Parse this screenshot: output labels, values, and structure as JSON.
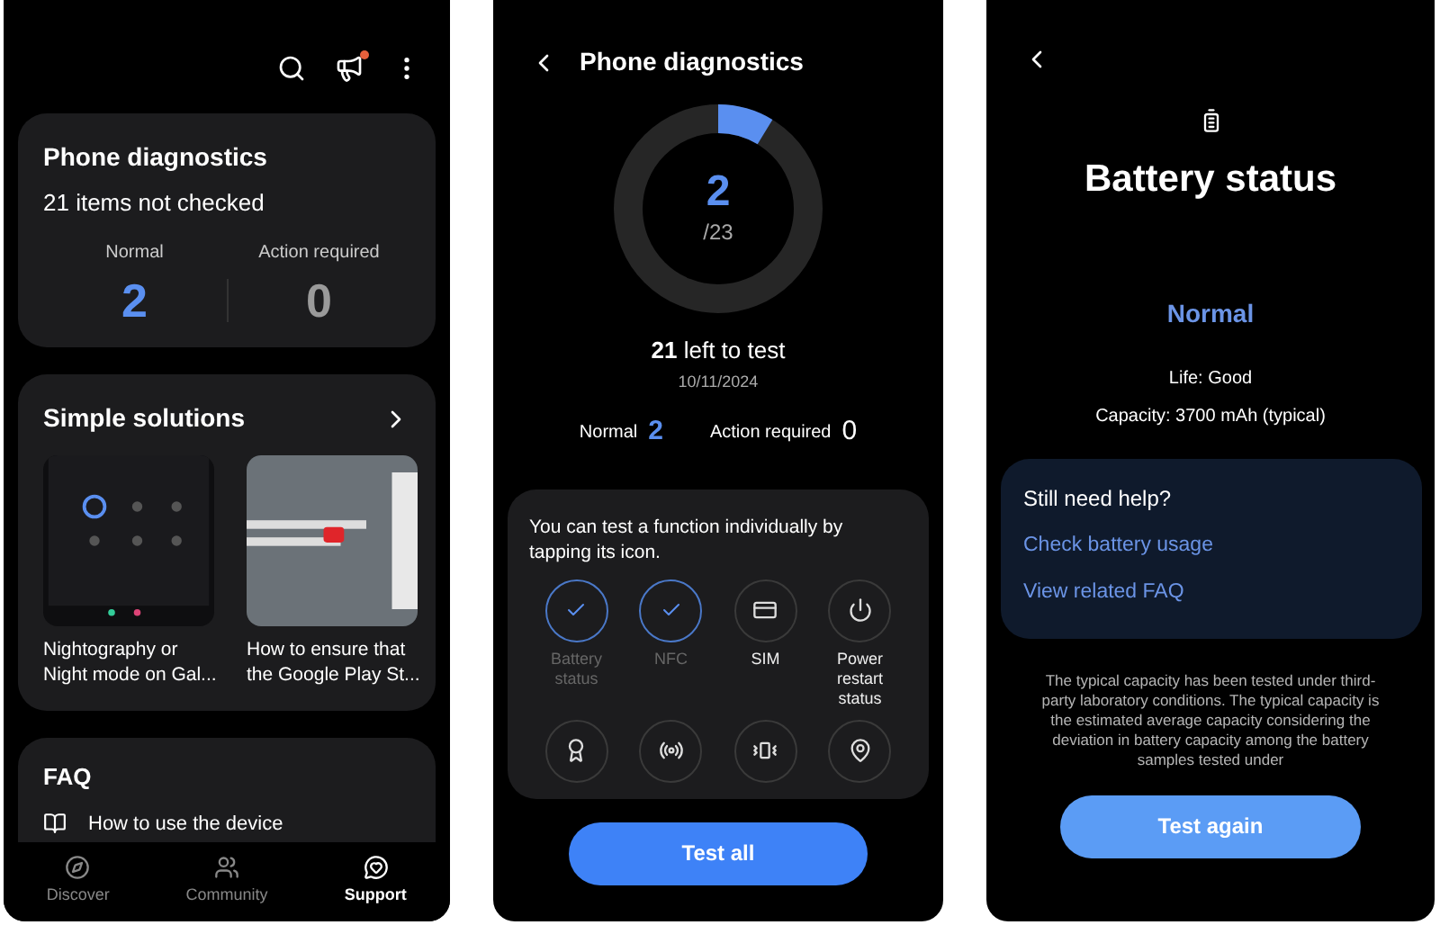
{
  "home": {
    "diagnostics": {
      "title": "Phone diagnostics",
      "subtitle": "21 items not checked",
      "stats": [
        {
          "label": "Normal",
          "value": "2",
          "kind": "normal"
        },
        {
          "label": "Action required",
          "value": "0",
          "kind": "action"
        }
      ]
    },
    "solutions": {
      "title": "Simple solutions",
      "items": [
        {
          "title": "Nightography or Night mode on Gal..."
        },
        {
          "title": "How to ensure that the Google Play St..."
        }
      ]
    },
    "faq": {
      "title": "FAQ",
      "item": "How to use the device"
    },
    "nav": [
      {
        "label": "Discover",
        "selected": false,
        "kind": "discover"
      },
      {
        "label": "Community",
        "selected": false,
        "kind": "community"
      },
      {
        "label": "Support",
        "selected": true,
        "kind": "support"
      }
    ],
    "notification_badge": true
  },
  "diagnostics": {
    "title": "Phone diagnostics",
    "progress": {
      "level": 0.087,
      "count": "2",
      "total": "/23"
    },
    "left": "**21** left to test",
    "date": "10/11/2024",
    "normal_label": "Normal",
    "normal_value": "2",
    "action_label": "Action required",
    "action_value": "0",
    "hint": "You can test a function individually by tapping its icon.",
    "tests": [
      {
        "label": "Battery status",
        "tested": true
      },
      {
        "label": "NFC",
        "tested": true
      },
      {
        "label": "SIM",
        "tested": false,
        "kind": "sim"
      },
      {
        "label": "Power restart status",
        "tested": false,
        "kind": "power"
      },
      {
        "tested": false,
        "kind": "award"
      },
      {
        "tested": false,
        "kind": "antenna"
      },
      {
        "tested": false,
        "kind": "vibration"
      },
      {
        "tested": false,
        "kind": "location"
      }
    ],
    "button": "Test all"
  },
  "battery": {
    "title": "Battery status",
    "status": "Normal",
    "life": "Life: Good",
    "capacity": "Capacity: 3700 mAh (typical)",
    "help_title": "Still need help?",
    "links": [
      "Check battery usage",
      "View related FAQ"
    ],
    "note": "The typical capacity has been tested under third-party laboratory conditions. The typical capacity is the estimated average capacity considering the deviation in battery capacity among the battery samples tested under",
    "button": "Test again"
  }
}
